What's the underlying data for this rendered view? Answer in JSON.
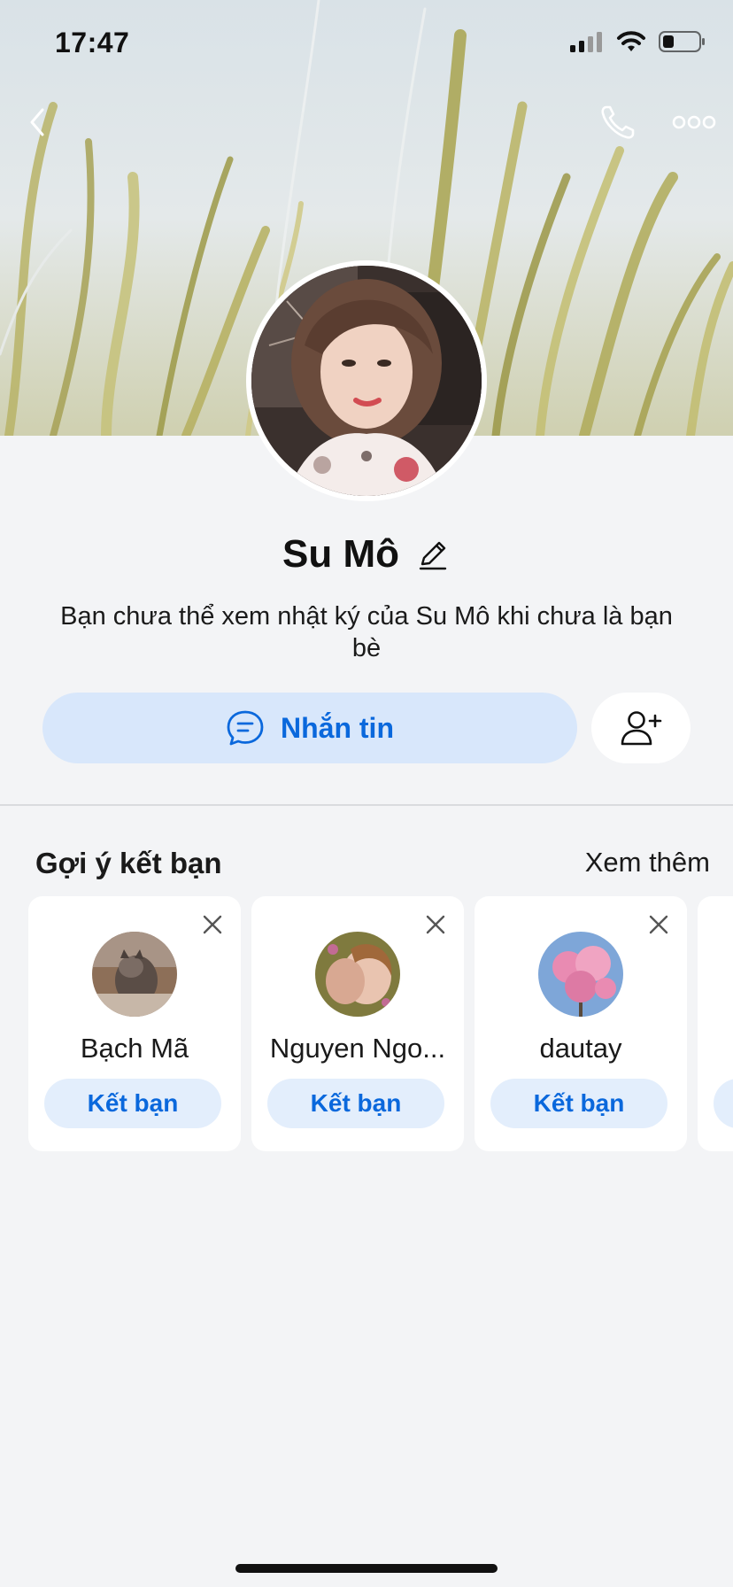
{
  "status_bar": {
    "time": "17:47"
  },
  "icons": {
    "back": "chevron-left-icon",
    "call": "phone-icon",
    "more": "more-horizontal-icon",
    "edit": "pencil-icon",
    "message": "chat-bubble-icon",
    "add_friend": "user-plus-icon",
    "dismiss": "close-icon"
  },
  "profile": {
    "name": "Su Mô",
    "description": "Bạn chưa thể xem nhật ký của Su Mô khi chưa là bạn bè",
    "message_button": "Nhắn tin"
  },
  "suggestions": {
    "title": "Gợi ý kết bạn",
    "see_more": "Xem thêm",
    "items": [
      {
        "name": "Bạch Mã",
        "action": "Kết bạn"
      },
      {
        "name": "Nguyen Ngo...",
        "action": "Kết bạn"
      },
      {
        "name": "dautay",
        "action": "Kết bạn"
      }
    ]
  },
  "colors": {
    "accent": "#0a68dc",
    "message_button_bg": "#d8e7fb",
    "page_bg": "#f3f4f6"
  }
}
